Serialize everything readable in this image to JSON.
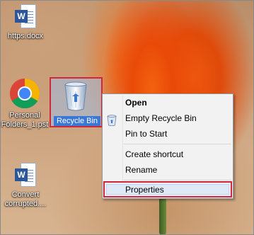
{
  "desktop": {
    "icons": [
      {
        "label": "https.docx",
        "icon": "word-document-icon"
      },
      {
        "label_line1": "Personal",
        "label_line2": "Folders_1.pst",
        "icon": "chrome-icon"
      },
      {
        "label": "Recycle Bin",
        "icon": "recycle-bin-icon",
        "selected": true
      },
      {
        "label_line1": "Convert",
        "label_line2": "corrupted....",
        "icon": "word-document-icon"
      }
    ]
  },
  "context_menu": {
    "items": [
      {
        "label": "Open",
        "bold": true
      },
      {
        "label": "Empty Recycle Bin"
      },
      {
        "label": "Pin to Start"
      },
      {
        "label": "Create shortcut"
      },
      {
        "label": "Rename"
      },
      {
        "label": "Properties",
        "highlighted": true
      }
    ]
  },
  "colors": {
    "highlight_border": "#d2263a",
    "selection_fill": "#3a78d6",
    "word_blue": "#2b579a"
  }
}
